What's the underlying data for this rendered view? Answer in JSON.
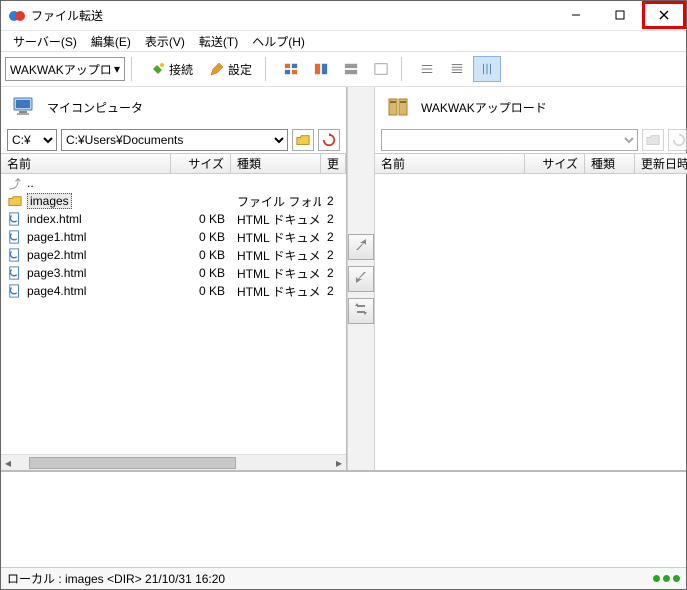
{
  "window": {
    "title": "ファイル転送"
  },
  "menu": {
    "server": "サーバー(S)",
    "edit": "編集(E)",
    "view": "表示(V)",
    "transfer": "転送(T)",
    "help": "ヘルプ(H)"
  },
  "toolbar": {
    "profile_selected": "WAKWAKアップロ",
    "connect": "接続",
    "settings": "設定"
  },
  "local": {
    "header": "マイコンピュータ",
    "drive": "C:¥",
    "path": "C:¥Users¥Documents",
    "columns": {
      "name": "名前",
      "size": "サイズ",
      "type": "種類",
      "date": "更"
    },
    "updir": "..",
    "items": [
      {
        "name": "images",
        "size": "",
        "type": "ファイル フォルダー",
        "date": "2",
        "kind": "folder",
        "selected": true
      },
      {
        "name": "index.html",
        "size": "0 KB",
        "type": "HTML ドキュメント",
        "date": "2",
        "kind": "html"
      },
      {
        "name": "page1.html",
        "size": "0 KB",
        "type": "HTML ドキュメント",
        "date": "2",
        "kind": "html"
      },
      {
        "name": "page2.html",
        "size": "0 KB",
        "type": "HTML ドキュメント",
        "date": "2",
        "kind": "html"
      },
      {
        "name": "page3.html",
        "size": "0 KB",
        "type": "HTML ドキュメント",
        "date": "2",
        "kind": "html"
      },
      {
        "name": "page4.html",
        "size": "0 KB",
        "type": "HTML ドキュメント",
        "date": "2",
        "kind": "html"
      }
    ]
  },
  "remote": {
    "header": "WAKWAKアップロード",
    "path": "",
    "columns": {
      "name": "名前",
      "size": "サイズ",
      "type": "種類",
      "date": "更新日時"
    },
    "items": []
  },
  "status": {
    "text": "ローカル : images <DIR> 21/10/31 16:20"
  }
}
